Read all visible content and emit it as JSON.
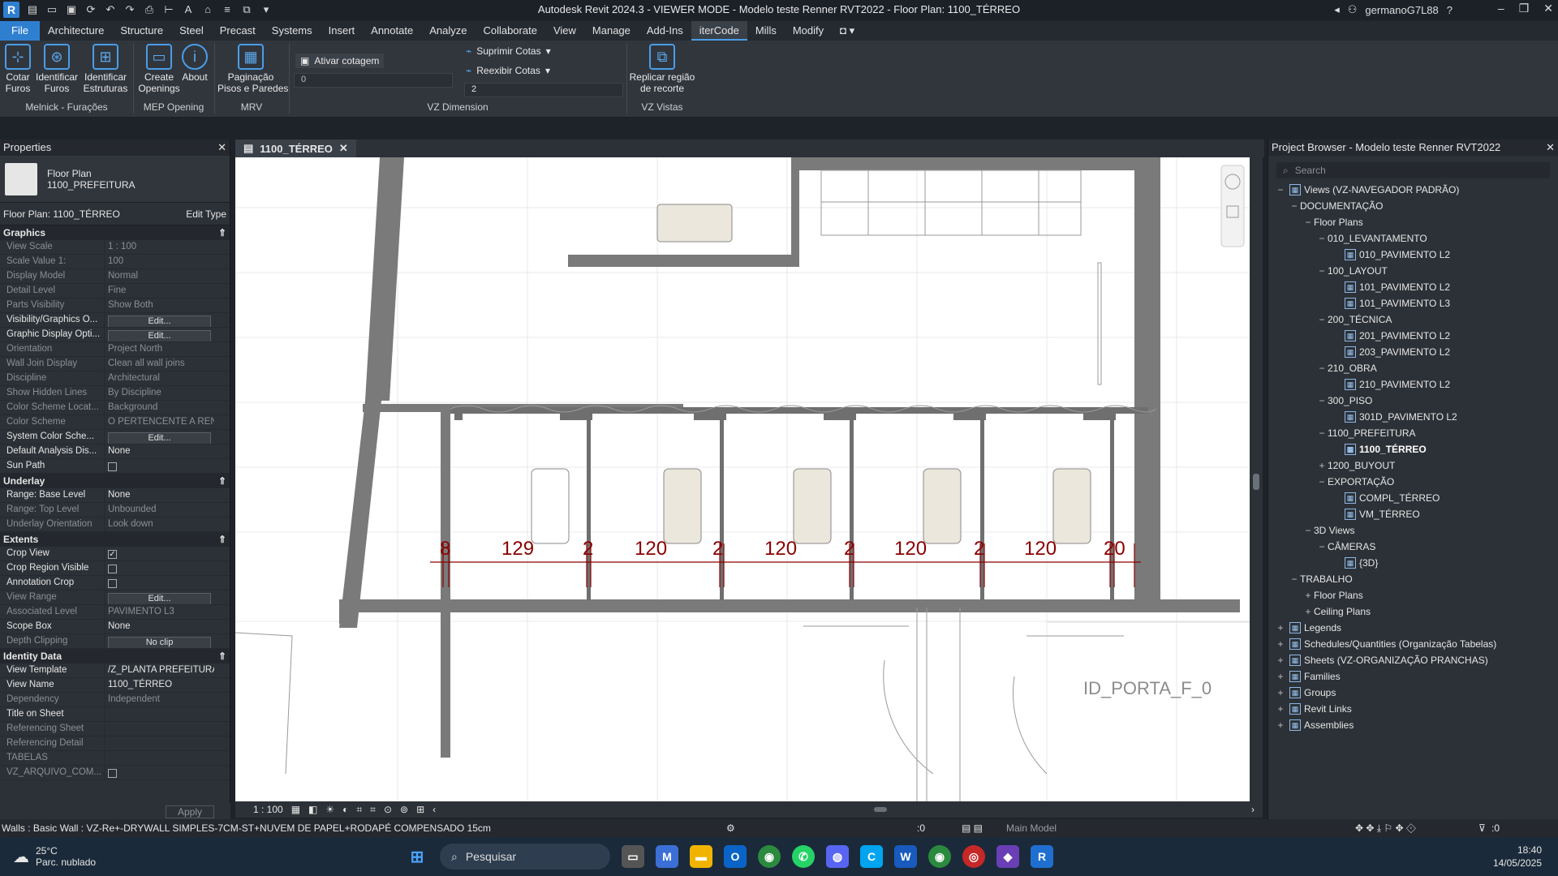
{
  "window": {
    "title": "Autodesk Revit 2024.3 - VIEWER MODE - Modelo teste Renner RVT2022 - Floor Plan: 1100_TÉRREO",
    "user": "germanoG7L88"
  },
  "menu": {
    "tabs": [
      "File",
      "Architecture",
      "Structure",
      "Steel",
      "Precast",
      "Systems",
      "Insert",
      "Annotate",
      "Analyze",
      "Collaborate",
      "View",
      "Manage",
      "Add-Ins",
      "iterCode",
      "Mills",
      "Modify"
    ]
  },
  "ribbon": {
    "buttons": {
      "cotar": "Cotar\nFuros",
      "identificar_furos": "Identificar\nFuros",
      "identificar_estr": "Identificar\nEstruturas",
      "create_openings": "Create\nOpenings",
      "about": "About",
      "paginacao": "Paginação\nPisos e Paredes",
      "ativar": "Ativar cotagem",
      "suprimir": "Suprimir Cotas",
      "reexibir": "Reexibir Cotas",
      "replicar": "Replicar região\nde recorte"
    },
    "fields": {
      "ativar_value": "0",
      "dimension_value": "2"
    },
    "panels": [
      "Melnick - Furações",
      "MEP Opening",
      "MRV",
      "VZ Dimension",
      "VZ Vistas"
    ]
  },
  "properties": {
    "title": "Properties",
    "type_family": "Floor Plan",
    "type_name": "1100_PREFEITURA",
    "instance_filter": "Floor Plan: 1100_TÉRREO",
    "edit_type": "Edit Type",
    "sections": {
      "graphics": "Graphics",
      "underlay": "Underlay",
      "extents": "Extents",
      "identity": "Identity Data"
    },
    "graphics": [
      [
        "View Scale",
        "1 : 100",
        true
      ],
      [
        "Scale Value    1:",
        "100",
        true
      ],
      [
        "Display Model",
        "Normal",
        true
      ],
      [
        "Detail Level",
        "Fine",
        true
      ],
      [
        "Parts Visibility",
        "Show Both",
        true
      ],
      [
        "Visibility/Graphics O...",
        "Edit...",
        false
      ],
      [
        "Graphic Display Opti...",
        "Edit...",
        false
      ],
      [
        "Orientation",
        "Project North",
        true
      ],
      [
        "Wall Join Display",
        "Clean all wall joins",
        true
      ],
      [
        "Discipline",
        "Architectural",
        true
      ],
      [
        "Show Hidden Lines",
        "By Discipline",
        true
      ],
      [
        "Color Scheme Locat...",
        "Background",
        true
      ],
      [
        "Color Scheme",
        "O PERTENCENTE A RENI",
        true
      ],
      [
        "System Color Sche...",
        "Edit...",
        false
      ],
      [
        "Default Analysis Dis...",
        "None",
        false
      ],
      [
        "Sun Path",
        "",
        false
      ]
    ],
    "underlay": [
      [
        "Range: Base Level",
        "None",
        false
      ],
      [
        "Range: Top Level",
        "Unbounded",
        true
      ],
      [
        "Underlay Orientation",
        "Look down",
        true
      ]
    ],
    "extents": [
      [
        "Crop View",
        "✓",
        false
      ],
      [
        "Crop Region Visible",
        "",
        false
      ],
      [
        "Annotation Crop",
        "",
        false
      ],
      [
        "View Range",
        "Edit...",
        true
      ],
      [
        "Associated Level",
        "PAVIMENTO L3",
        true
      ],
      [
        "Scope Box",
        "None",
        false
      ],
      [
        "Depth Clipping",
        "No clip",
        true
      ]
    ],
    "identity": [
      [
        "View Template",
        "/Z_PLANTA PREFEITURA",
        false
      ],
      [
        "View Name",
        "1100_TÉRREO",
        false
      ],
      [
        "Dependency",
        "Independent",
        true
      ],
      [
        "Title on Sheet",
        "",
        false
      ],
      [
        "Referencing Sheet",
        "",
        true
      ],
      [
        "Referencing Detail",
        "",
        true
      ],
      [
        "TABELAS",
        "",
        true
      ],
      [
        "VZ_ARQUIVO_COM...",
        "",
        true
      ]
    ],
    "apply": "Apply"
  },
  "view": {
    "tab": "1100_TÉRREO",
    "scale": "1 : 100",
    "dims": [
      "8",
      "129",
      "2",
      "120",
      "2",
      "120",
      "2",
      "120",
      "2",
      "120",
      "20"
    ],
    "tag": "ID_PORTA_F_0"
  },
  "browser": {
    "title": "Project Browser - Modelo teste Renner RVT2022",
    "search": "Search",
    "nodes": [
      [
        "Views (VZ-NAVEGADOR PADRÃO)",
        0,
        "−",
        true,
        false
      ],
      [
        "DOCUMENTAÇÃO",
        1,
        "−",
        false,
        false
      ],
      [
        "Floor Plans",
        2,
        "−",
        false,
        false
      ],
      [
        "010_LEVANTAMENTO",
        3,
        "−",
        false,
        false
      ],
      [
        "010_PAVIMENTO L2",
        4,
        "",
        true,
        false
      ],
      [
        "100_LAYOUT",
        3,
        "−",
        false,
        false
      ],
      [
        "101_PAVIMENTO L2",
        4,
        "",
        true,
        false
      ],
      [
        "101_PAVIMENTO L3",
        4,
        "",
        true,
        false
      ],
      [
        "200_TÉCNICA",
        3,
        "−",
        false,
        false
      ],
      [
        "201_PAVIMENTO L2",
        4,
        "",
        true,
        false
      ],
      [
        "203_PAVIMENTO L2",
        4,
        "",
        true,
        false
      ],
      [
        "210_OBRA",
        3,
        "−",
        false,
        false
      ],
      [
        "210_PAVIMENTO L2",
        4,
        "",
        true,
        false
      ],
      [
        "300_PISO",
        3,
        "−",
        false,
        false
      ],
      [
        "301D_PAVIMENTO L2",
        4,
        "",
        true,
        false
      ],
      [
        "1100_PREFEITURA",
        3,
        "−",
        false,
        false
      ],
      [
        "1100_TÉRREO",
        4,
        "",
        true,
        true
      ],
      [
        "1200_BUYOUT",
        3,
        "+",
        false,
        false
      ],
      [
        "EXPORTAÇÃO",
        3,
        "−",
        false,
        false
      ],
      [
        "COMPL_TÉRREO",
        4,
        "",
        true,
        false
      ],
      [
        "VM_TÉRREO",
        4,
        "",
        true,
        false
      ],
      [
        "3D Views",
        2,
        "−",
        false,
        false
      ],
      [
        "CÂMERAS",
        3,
        "−",
        false,
        false
      ],
      [
        "{3D}",
        4,
        "",
        true,
        false
      ],
      [
        "TRABALHO",
        1,
        "−",
        false,
        false
      ],
      [
        "Floor Plans",
        2,
        "+",
        false,
        false
      ],
      [
        "Ceiling Plans",
        2,
        "+",
        false,
        false
      ],
      [
        "Legends",
        0,
        "+",
        true,
        false
      ],
      [
        "Schedules/Quantities (Organização Tabelas)",
        0,
        "+",
        true,
        false
      ],
      [
        "Sheets (VZ-ORGANIZAÇÃO PRANCHAS)",
        0,
        "+",
        true,
        false
      ],
      [
        "Families",
        0,
        "+",
        true,
        false
      ],
      [
        "Groups",
        0,
        "+",
        true,
        false
      ],
      [
        "Revit Links",
        0,
        "+",
        true,
        false
      ],
      [
        "Assemblies",
        0,
        "+",
        true,
        false
      ]
    ]
  },
  "status": {
    "text": "Walls : Basic Wall : VZ-Re+-DRYWALL SIMPLES-7CM-ST+NUVEM DE PAPEL+RODAPÉ COMPENSADO 15cm",
    "zero": ":0",
    "model": "Main Model",
    "filter": ":0"
  },
  "taskbar": {
    "temp": "25°C",
    "weather": "Parc. nublado",
    "search": "Pesquisar",
    "time": "18:40",
    "date": "14/05/2025"
  }
}
